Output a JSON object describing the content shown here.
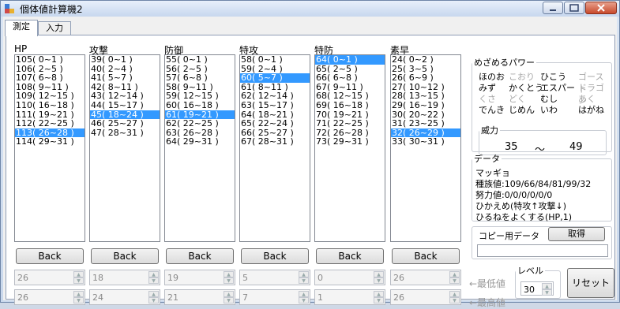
{
  "window": {
    "title": "個体値計算機2"
  },
  "tabs": [
    "測定",
    "入力"
  ],
  "columns": [
    {
      "label": "HP",
      "back": "Back",
      "min": "26",
      "max": "26",
      "items": [
        "105( 0~1 )",
        "106( 2~5 )",
        "107( 6~8 )",
        "108( 9~11 )",
        "109( 12~15 )",
        "110( 16~18 )",
        "111( 19~21 )",
        "112( 22~25 )",
        "113( 26~28 )",
        "114( 29~31 )"
      ],
      "selected": 8
    },
    {
      "label": "攻撃",
      "back": "Back",
      "min": "18",
      "max": "24",
      "items": [
        "39( 0~1 )",
        "40( 2~4 )",
        "41( 5~7 )",
        "42( 8~11 )",
        "43( 12~14 )",
        "44( 15~17 )",
        "45( 18~24 )",
        "46( 25~27 )",
        "47( 28~31 )"
      ],
      "selected": 6
    },
    {
      "label": "防御",
      "back": "Back",
      "min": "19",
      "max": "21",
      "items": [
        "55( 0~1 )",
        "56( 2~5 )",
        "57( 6~8 )",
        "58( 9~11 )",
        "59( 12~15 )",
        "60( 16~18 )",
        "61( 19~21 )",
        "62( 22~25 )",
        "63( 26~28 )",
        "64( 29~31 )"
      ],
      "selected": 6
    },
    {
      "label": "特攻",
      "back": "Back",
      "min": "5",
      "max": "7",
      "items": [
        "58( 0~1 )",
        "59( 2~4 )",
        "60( 5~7 )",
        "61( 8~11 )",
        "62( 12~14 )",
        "63( 15~17 )",
        "64( 18~21 )",
        "65( 22~24 )",
        "66( 25~27 )",
        "67( 28~31 )"
      ],
      "selected": 2
    },
    {
      "label": "特防",
      "back": "Back",
      "min": "0",
      "max": "1",
      "items": [
        "64( 0~1 )",
        "65( 2~5 )",
        "66( 6~8 )",
        "67( 9~11 )",
        "68( 12~15 )",
        "69( 16~18 )",
        "70( 19~21 )",
        "71( 22~25 )",
        "72( 26~28 )",
        "73( 29~31 )"
      ],
      "selected": 0
    },
    {
      "label": "素早",
      "back": "Back",
      "min": "26",
      "max": "26",
      "items": [
        "24( 0~2 )",
        "25( 3~5 )",
        "26( 6~9 )",
        "27( 10~12 )",
        "28( 13~15 )",
        "29( 16~19 )",
        "30( 20~22 )",
        "31( 23~25 )",
        "32( 26~29 )",
        "33( 30~31 )"
      ],
      "selected": 8
    }
  ],
  "labels": {
    "min": "←最低値",
    "max": "←最高値",
    "level": "レベル",
    "reset": "リセット"
  },
  "level_value": "30",
  "hidden_power": {
    "legend": "めざめるパワー",
    "types": [
      {
        "name": "ほのお",
        "dim": false
      },
      {
        "name": "こおり",
        "dim": true
      },
      {
        "name": "ひこう",
        "dim": false
      },
      {
        "name": "ゴースト",
        "dim": true
      },
      {
        "name": "みず",
        "dim": false
      },
      {
        "name": "かくとう",
        "dim": false
      },
      {
        "name": "エスパー",
        "dim": false
      },
      {
        "name": "ドラゴン",
        "dim": true
      },
      {
        "name": "くさ",
        "dim": true
      },
      {
        "name": "どく",
        "dim": true
      },
      {
        "name": "むし",
        "dim": false
      },
      {
        "name": "あく",
        "dim": true
      },
      {
        "name": "でんき",
        "dim": false
      },
      {
        "name": "じめん",
        "dim": false
      },
      {
        "name": "いわ",
        "dim": false
      },
      {
        "name": "はがね",
        "dim": false
      }
    ],
    "power_legend": "威力",
    "power_min": "35",
    "power_sep": "〜",
    "power_max": "49"
  },
  "data": {
    "legend": "データ",
    "lines": [
      "マッギョ",
      "種族値:109/66/84/81/99/32",
      "努力値:0/0/0/0/0/0",
      "ひかえめ(特攻↑攻撃↓)",
      "ひるねをよくする(HP,1)"
    ]
  },
  "copy": {
    "legend": "コピー用データ",
    "button": "取得"
  }
}
